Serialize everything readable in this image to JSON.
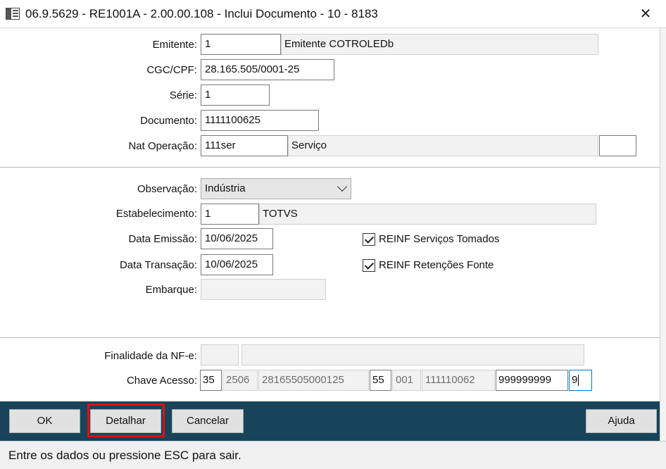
{
  "window": {
    "title": "06.9.5629 - RE1001A - 2.00.00.108 - Inclui Documento - 10 - 8183",
    "close_symbol": "✕"
  },
  "form": {
    "emitente": {
      "label": "Emitente:",
      "code": "1",
      "name": "Emitente COTROLEDb"
    },
    "cgc_cpf": {
      "label": "CGC/CPF:",
      "value": "28.165.505/0001-25"
    },
    "serie": {
      "label": "Série:",
      "value": "1"
    },
    "documento": {
      "label": "Documento:",
      "value": "1111100625"
    },
    "nat_operacao": {
      "label": "Nat Operação:",
      "code": "111ser",
      "description": "Serviço",
      "extra": ""
    },
    "observacao": {
      "label": "Observação:",
      "selected": "Indústria"
    },
    "estabelecimento": {
      "label": "Estabelecimento:",
      "code": "1",
      "name": "TOTVS"
    },
    "data_emissao": {
      "label": "Data Emissão:",
      "value": "10/06/2025"
    },
    "data_transacao": {
      "label": "Data Transação:",
      "value": "10/06/2025"
    },
    "embarque": {
      "label": "Embarque:",
      "value": ""
    },
    "reinf_servicos_tomados": {
      "label": "REINF Serviços Tomados",
      "checked": true
    },
    "reinf_retencoes_fonte": {
      "label": "REINF Retenções Fonte",
      "checked": true
    },
    "finalidade_nfe": {
      "label": "Finalidade da NF-e:",
      "code": "",
      "description": ""
    },
    "chave_acesso": {
      "label": "Chave Acesso:",
      "uf": "35",
      "aamm": "2506",
      "cnpj": "28165505000125",
      "modelo": "55",
      "serie": "001",
      "numero": "111110062",
      "codigo": "999999999",
      "dv": "9"
    }
  },
  "buttons": {
    "ok": "OK",
    "detalhar": "Detalhar",
    "cancelar": "Cancelar",
    "ajuda": "Ajuda"
  },
  "status_bar": {
    "text": "Entre os dados ou pressione ESC para sair."
  },
  "colors": {
    "button_bar": "#17445a",
    "highlight": "#e11010"
  }
}
